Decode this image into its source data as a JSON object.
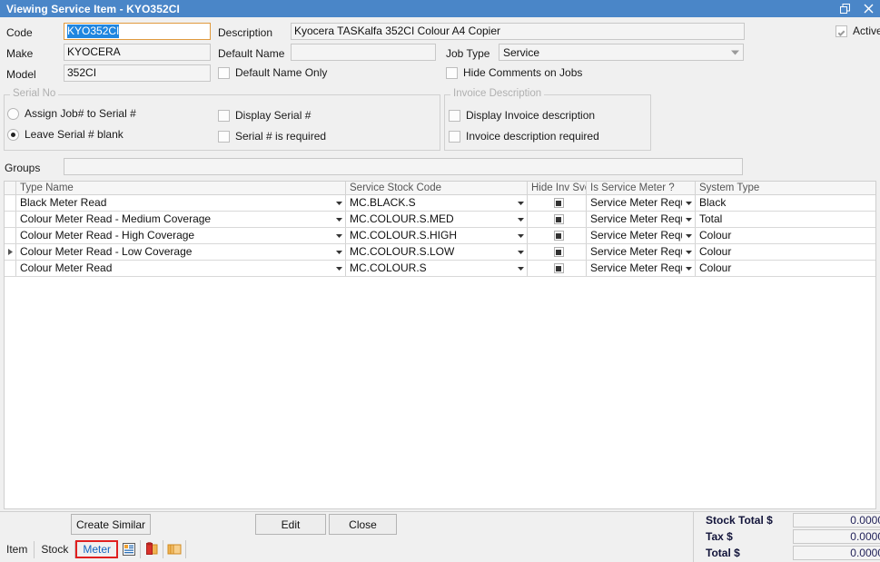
{
  "window": {
    "title": "Viewing Service Item - KYO352CI",
    "title_bar_color": "#4a86c8",
    "restore_icon": "restore-icon",
    "close_icon": "close-icon"
  },
  "form": {
    "code": {
      "label": "Code",
      "value": "KYO352CI",
      "selected": true
    },
    "make": {
      "label": "Make",
      "value": "KYOCERA"
    },
    "model": {
      "label": "Model",
      "value": "352CI"
    },
    "description": {
      "label": "Description",
      "value": "Kyocera TASKalfa 352CI Colour A4 Copier"
    },
    "default_name": {
      "label": "Default Name",
      "value": "",
      "placeholder": ""
    },
    "default_name_only": {
      "label": "Default Name Only",
      "checked": false
    },
    "job_type": {
      "label": "Job Type",
      "value": "Service",
      "options": [
        "Service"
      ]
    },
    "hide_comments_on_jobs": {
      "label": "Hide Comments on Jobs",
      "checked": false
    },
    "active": {
      "label": "Active",
      "checked": true
    },
    "groups": {
      "label": "Groups",
      "value": ""
    }
  },
  "serial_no_group": {
    "caption": "Serial No",
    "radios": [
      {
        "label": "Assign Job# to Serial #",
        "selected": false
      },
      {
        "label": "Leave Serial # blank",
        "selected": true
      }
    ],
    "checks": [
      {
        "label": "Display Serial #",
        "checked": false
      },
      {
        "label": "Serial # is required",
        "checked": false
      }
    ]
  },
  "invoice_description_group": {
    "caption": "Invoice Description",
    "checks": [
      {
        "label": "Display Invoice description",
        "checked": false
      },
      {
        "label": "Invoice description required",
        "checked": false
      }
    ]
  },
  "grid": {
    "columns": [
      "Type Name",
      "Service Stock Code",
      "Hide Inv Svc",
      "Is Service Meter ?",
      "System Type"
    ],
    "rows": [
      {
        "indicator": false,
        "type_name": "Black Meter Read",
        "stock_code": "MC.BLACK.S",
        "hide_inv_svc": "indeterminate",
        "is_service_meter": "Service Meter Require",
        "system_type": "Black"
      },
      {
        "indicator": false,
        "type_name": "Colour Meter Read - Medium Coverage",
        "stock_code": "MC.COLOUR.S.MED",
        "hide_inv_svc": "indeterminate",
        "is_service_meter": "Service Meter Require",
        "system_type": "Total"
      },
      {
        "indicator": false,
        "type_name": "Colour Meter Read - High Coverage",
        "stock_code": "MC.COLOUR.S.HIGH",
        "hide_inv_svc": "indeterminate",
        "is_service_meter": "Service Meter Require",
        "system_type": "Colour"
      },
      {
        "indicator": true,
        "type_name": "Colour Meter Read - Low Coverage",
        "stock_code": "MC.COLOUR.S.LOW",
        "hide_inv_svc": "indeterminate",
        "is_service_meter": "Service Meter Require",
        "system_type": "Colour"
      },
      {
        "indicator": false,
        "type_name": "Colour Meter Read",
        "stock_code": "MC.COLOUR.S",
        "hide_inv_svc": "indeterminate",
        "is_service_meter": "Service Meter Require",
        "system_type": "Colour"
      }
    ]
  },
  "buttons": {
    "create_similar": "Create Similar",
    "edit": "Edit",
    "close": "Close"
  },
  "tabbar": {
    "items": [
      {
        "label": "Item",
        "active": false
      },
      {
        "label": "Stock",
        "active": false
      },
      {
        "label": "Meter",
        "active": true
      }
    ],
    "icons": [
      "form-document-icon",
      "clipboard-icon",
      "copy-folders-icon"
    ],
    "active_highlight_color": "#e02020",
    "active_text_color": "#1565c0"
  },
  "totals": {
    "rows": [
      {
        "label": "Stock Total $",
        "value": "0.0000"
      },
      {
        "label": "Tax $",
        "value": "0.0000"
      },
      {
        "label": "Total $",
        "value": "0.0000"
      }
    ]
  }
}
